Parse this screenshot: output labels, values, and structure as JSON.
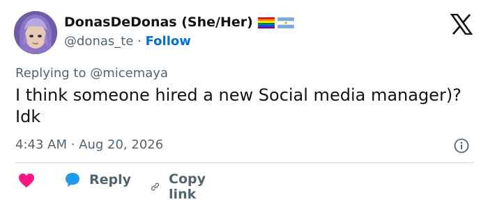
{
  "author": {
    "display_name": "DonasDeDonas (She/Her)",
    "handle": "@donas_te",
    "separator": "·",
    "follow_label": "Follow",
    "flags": [
      "rainbow-pride-flag",
      "argentina-flag"
    ]
  },
  "reply_context": {
    "prefix": "Replying to",
    "mention": "@micemaya"
  },
  "tweet": {
    "text": "I think someone hired a new Social media manager)? Idk",
    "timestamp": "4:43 AM · Aug 20, 2026"
  },
  "actions": {
    "like_icon": "heart-icon",
    "reply_label": "Reply",
    "copy_label": "Copy link"
  },
  "colors": {
    "accent": "#006fd6",
    "like": "#f91880",
    "reply_bubble": "#1d9bf0",
    "secondary_text": "#536471"
  }
}
